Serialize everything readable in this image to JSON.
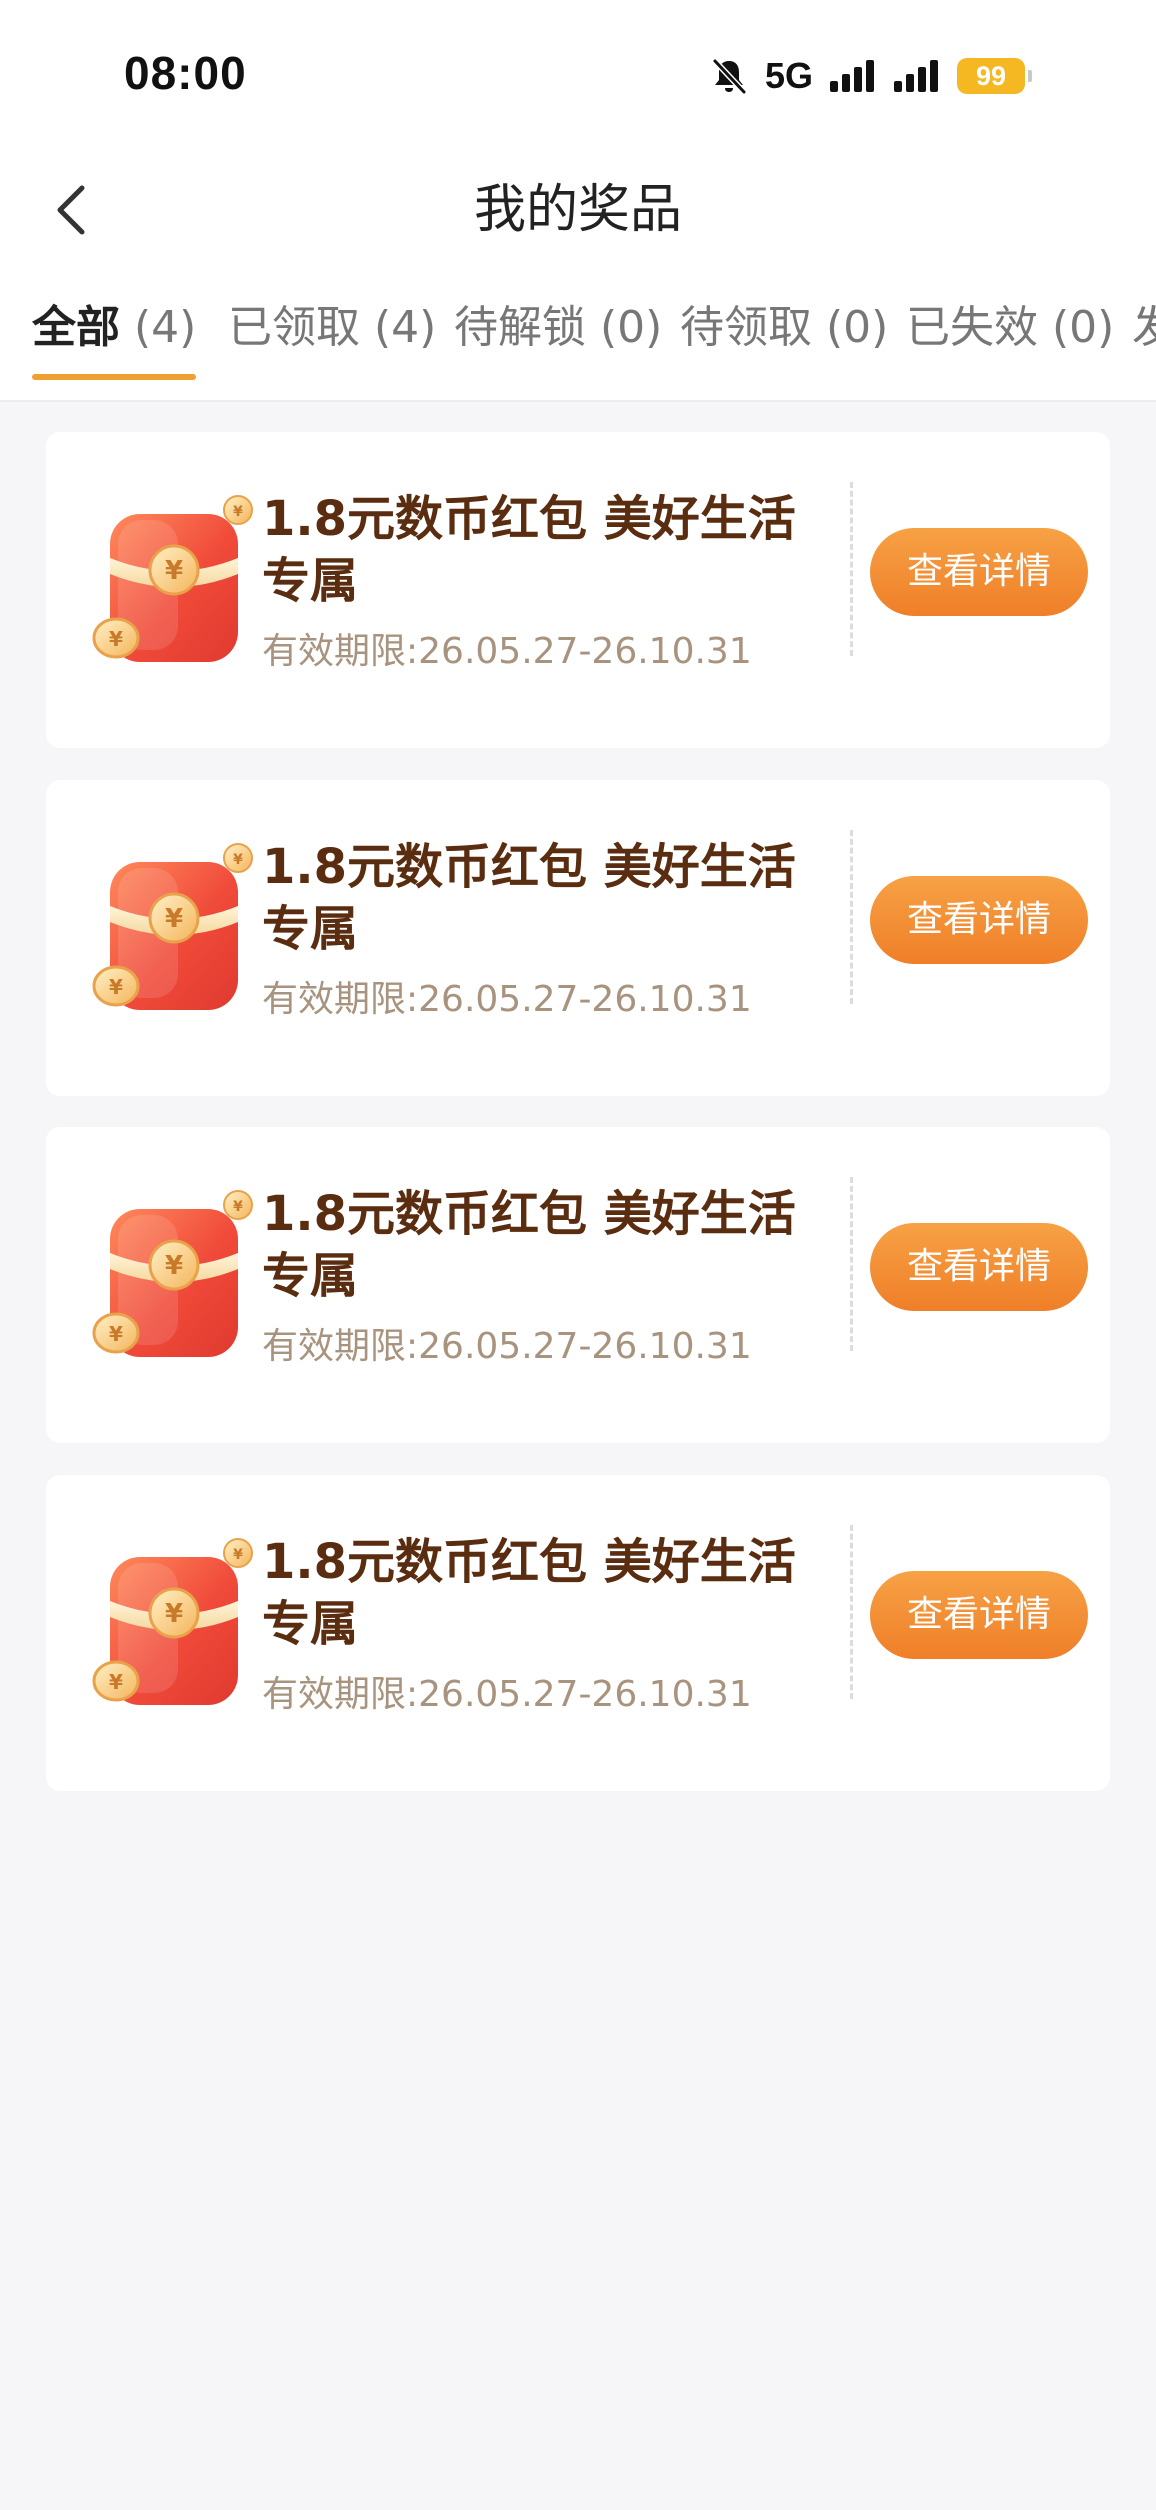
{
  "status_bar": {
    "time": "08:00",
    "network": "5G",
    "battery": "99",
    "icons": [
      "bell-muted-icon",
      "signal-icon",
      "signal-icon",
      "battery-icon"
    ]
  },
  "header": {
    "title": "我的奖品",
    "back_icon": "chevron-left-icon"
  },
  "tabs": [
    {
      "label": "全部",
      "count": " (4)",
      "active": true
    },
    {
      "label": "已领取",
      "count": " (4)",
      "active": false
    },
    {
      "label": "待解锁",
      "count": " (0)",
      "active": false
    },
    {
      "label": "待领取",
      "count": " (0)",
      "active": false
    },
    {
      "label": "已失效",
      "count": " (0)",
      "active": false
    },
    {
      "label": "发",
      "count": "",
      "active": false
    }
  ],
  "prizes": [
    {
      "title": "1.8元数币红包 美好生活专属",
      "validity": "有效期限:26.05.27-26.10.31",
      "button": "查看详情",
      "icon": "red-envelope-icon"
    },
    {
      "title": "1.8元数币红包 美好生活专属",
      "validity": "有效期限:26.05.27-26.10.31",
      "button": "查看详情",
      "icon": "red-envelope-icon"
    },
    {
      "title": "1.8元数币红包 美好生活专属",
      "validity": "有效期限:26.05.27-26.10.31",
      "button": "查看详情",
      "icon": "red-envelope-icon"
    },
    {
      "title": "1.8元数币红包 美好生活专属",
      "validity": "有效期限:26.05.27-26.10.31",
      "button": "查看详情",
      "icon": "red-envelope-icon"
    }
  ],
  "colors": {
    "accent": "#f08a2e",
    "tab_underline": "#f0a030",
    "title_text": "#5a2d10",
    "validity_text": "#a8937e",
    "battery": "#f5b823"
  }
}
